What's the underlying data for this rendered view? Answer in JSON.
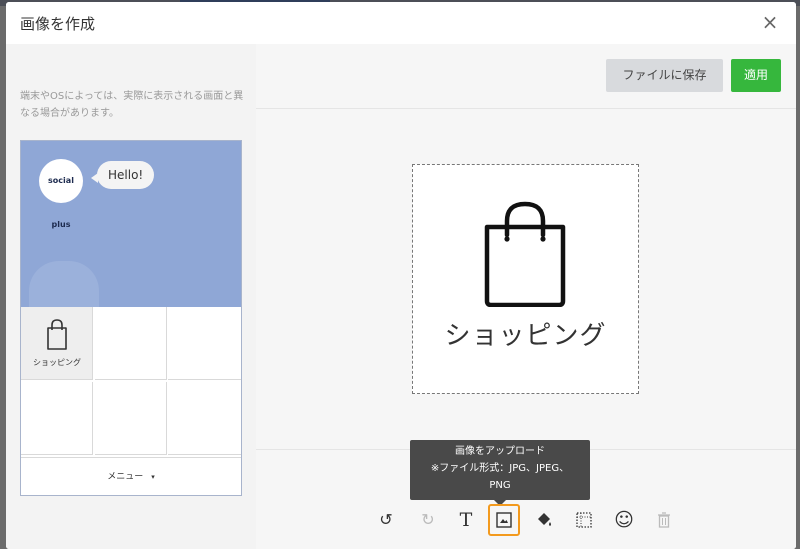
{
  "modal": {
    "title": "画像を作成",
    "close_label": "×"
  },
  "preview": {
    "note": "端末やOSによっては、実際に表示される画面と異なる場合があります。",
    "avatar_brand": "social plus",
    "bubble_text": "Hello!",
    "cell_label": "ショッピング",
    "menu_label": "メニュー",
    "menu_caret": "▾"
  },
  "actions": {
    "save_label": "ファイルに保存",
    "apply_label": "適用"
  },
  "canvas": {
    "text": "ショッピング",
    "icon": "shopping-bag-icon"
  },
  "tooltip": {
    "line1": "画像をアップロード",
    "line2": "※ファイル形式：JPG、JPEG、",
    "line3": "PNG"
  },
  "tools": [
    {
      "name": "undo-icon",
      "glyph": "↺"
    },
    {
      "name": "redo-icon",
      "glyph": "↻"
    },
    {
      "name": "text-icon",
      "glyph": "T"
    },
    {
      "name": "image-upload-icon",
      "glyph": ""
    },
    {
      "name": "fill-icon",
      "glyph": ""
    },
    {
      "name": "grid-icon",
      "glyph": ""
    },
    {
      "name": "emoji-icon",
      "glyph": "☺"
    },
    {
      "name": "trash-icon",
      "glyph": ""
    }
  ],
  "colors": {
    "accent_green": "#36b73d",
    "chat_bg": "#8fa7d6",
    "selected_tool_border": "#f39a1e"
  }
}
